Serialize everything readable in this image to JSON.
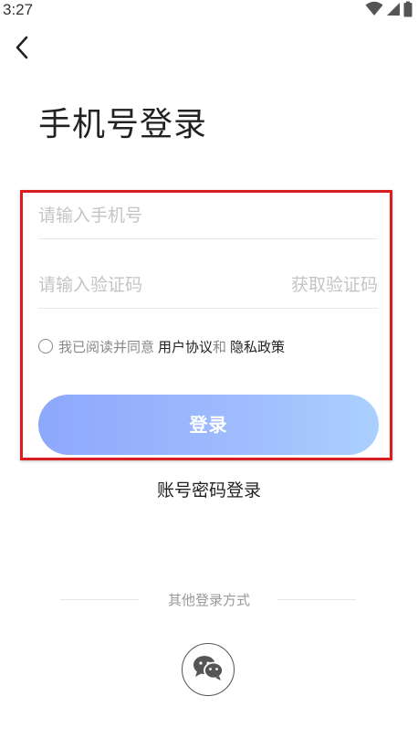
{
  "status_bar": {
    "time": "3:27",
    "icons": [
      "wifi-icon",
      "cellular-signal-icon",
      "battery-icon"
    ]
  },
  "header": {
    "back_icon": "chevron-left-icon"
  },
  "page": {
    "title": "手机号登录"
  },
  "form": {
    "phone_placeholder": "请输入手机号",
    "phone_value": "",
    "code_placeholder": "请输入验证码",
    "code_value": "",
    "get_code_label": "获取验证码",
    "agreement_prefix": "我已阅读并同意",
    "user_agreement_label": "用户协议",
    "and_label": "和",
    "privacy_policy_label": "隐私政策",
    "agreement_checked": false,
    "login_label": "登录"
  },
  "alt_login": {
    "password_login_label": "账号密码登录",
    "other_methods_label": "其他登录方式",
    "wechat_icon": "wechat-icon"
  },
  "colors": {
    "highlight_border": "#d81e1e",
    "login_gradient_start": "#8da8fb",
    "login_gradient_end": "#abd0ff",
    "placeholder": "#c4c4c4",
    "text": "#222222"
  }
}
